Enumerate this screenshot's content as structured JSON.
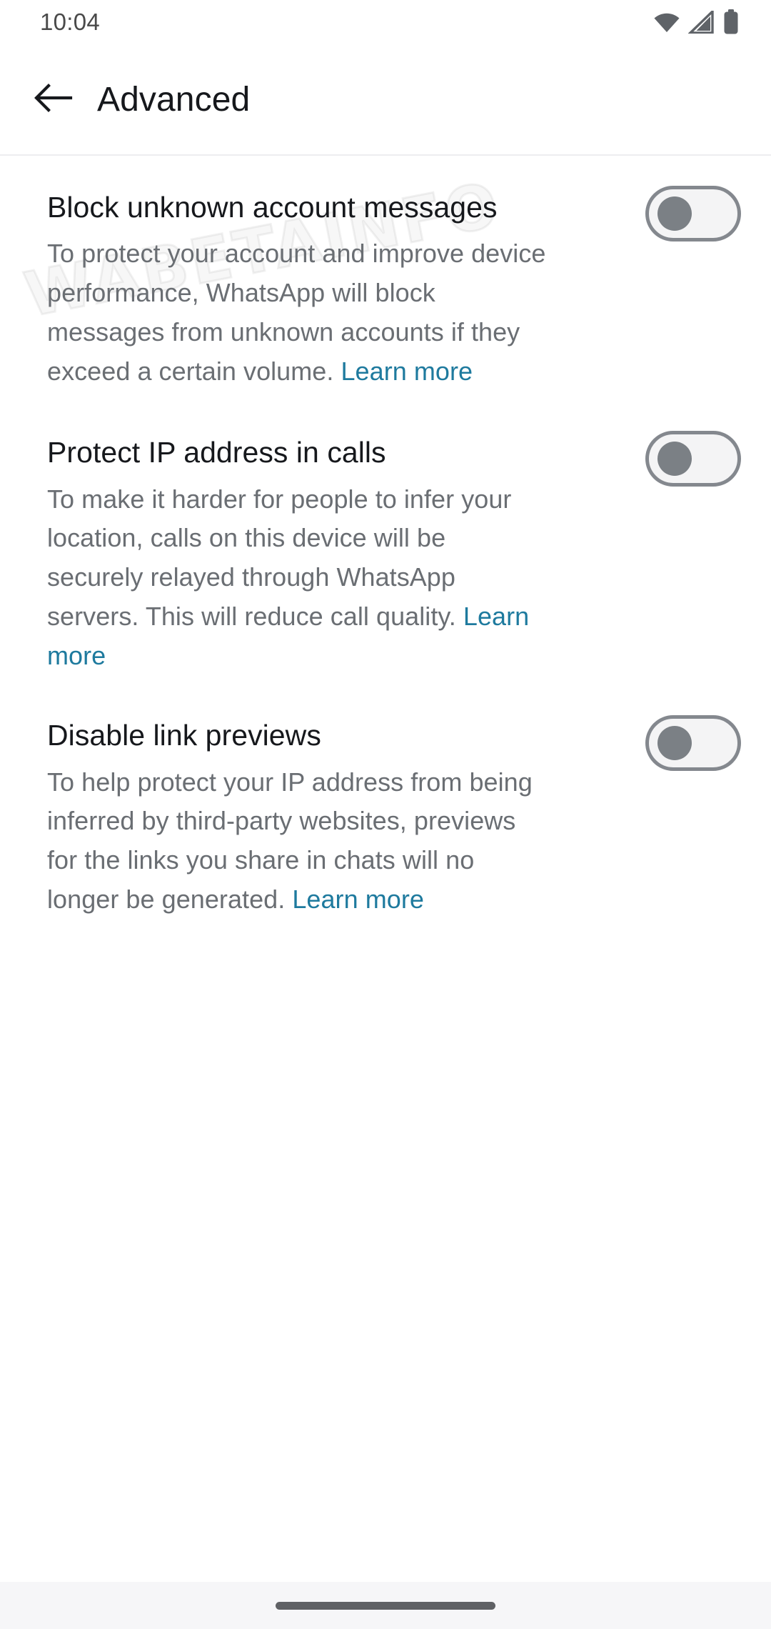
{
  "status_bar": {
    "time": "10:04",
    "icons": [
      "wifi-icon",
      "cell-signal-icon",
      "battery-icon"
    ]
  },
  "app_bar": {
    "back_icon": "arrow-left-icon",
    "title": "Advanced"
  },
  "watermark": {
    "text": "WABETAINFO"
  },
  "settings": [
    {
      "title": "Block unknown account messages",
      "description": "To protect your account and improve device performance, WhatsApp will block messages from unknown accounts if they exceed a certain volume. ",
      "link_label": "Learn more",
      "toggle": {
        "state": "off",
        "label": "Block unknown account messages toggle"
      }
    },
    {
      "title": "Protect IP address in calls",
      "description": "To make it harder for people to infer your location, calls on this device will be securely relayed through WhatsApp servers. This will reduce call quality. ",
      "link_label": "Learn more",
      "toggle": {
        "state": "off",
        "label": "Protect IP address in calls toggle"
      }
    },
    {
      "title": "Disable link previews",
      "description": "To help protect your IP address from being inferred by third-party websites, previews for the links you share in chats will no longer be generated. ",
      "link_label": "Learn more",
      "toggle": {
        "state": "off",
        "label": "Disable link previews toggle"
      }
    }
  ],
  "navigation_bar": {
    "handle": "gesture-home-handle"
  },
  "colors": {
    "link": "#1e7a9e",
    "title_text": "#16181c",
    "body_text": "#6a6e73",
    "toggle_track_border": "#84888e",
    "toggle_thumb": "#7b8085",
    "background": "#ffffff",
    "nav_background": "#f6f6f8"
  }
}
